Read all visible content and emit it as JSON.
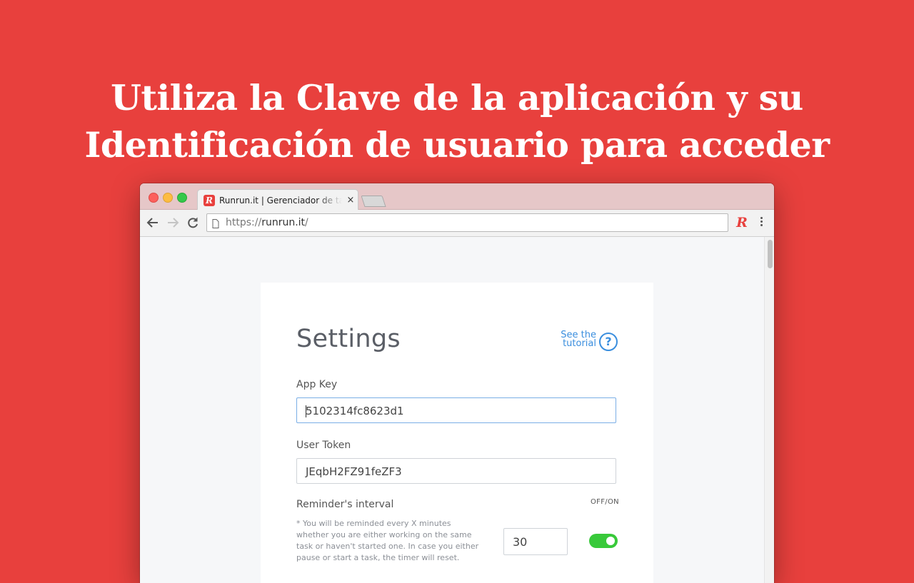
{
  "headline": {
    "line1": "Utiliza la Clave de la aplicación y su",
    "line2": "Identificación de usuario para acceder"
  },
  "browser": {
    "tab": {
      "favicon_letter": "R",
      "title": "Runrun.it | Gerenciador de tarefas",
      "close_glyph": "×"
    },
    "address": {
      "scheme": "https://",
      "host": "runrun.it",
      "path": "/"
    },
    "extension_letter": "R"
  },
  "settings": {
    "title": "Settings",
    "tutorial_line1": "See the",
    "tutorial_line2": "tutorial",
    "help_glyph": "?",
    "app_key": {
      "label": "App Key",
      "value": "5102314fc8623d1"
    },
    "user_token": {
      "label": "User Token",
      "value": "JEqbH2FZ91feZF3"
    },
    "reminder": {
      "label": "Reminder's interval",
      "offon_label": "OFF/ON",
      "help_text": "* You will be reminded every X minutes whether you are either working on the same task or haven't started one. In case you either pause or start a task, the timer will reset.",
      "value": "30",
      "enabled": true
    }
  },
  "colors": {
    "background": "#e8403d",
    "accent_blue": "#3a8ede",
    "toggle_on": "#38c93a"
  }
}
